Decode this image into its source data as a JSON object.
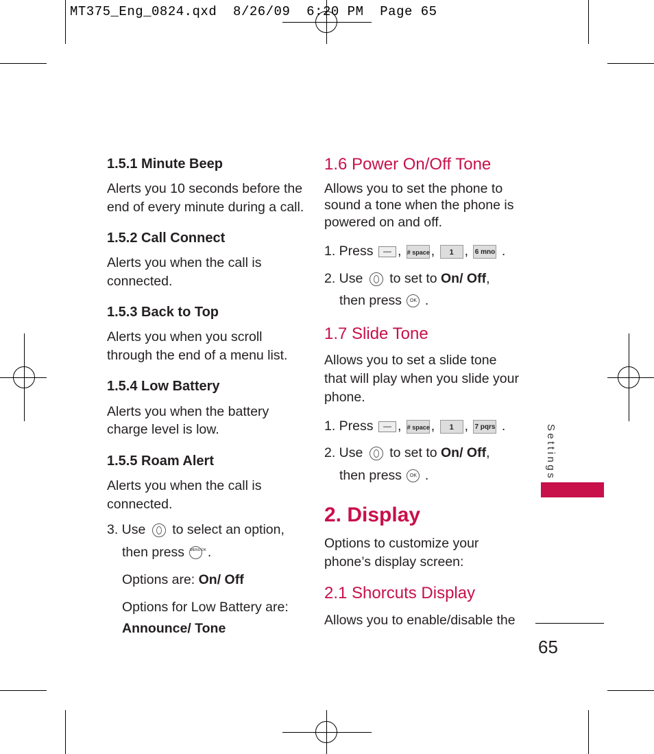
{
  "slug": "MT375_Eng_0824.qxd  8/26/09  6:20 PM  Page 65",
  "left_column": {
    "s151": {
      "title": "1.5.1 Minute Beep",
      "lines": [
        "Alerts you 10 seconds before the",
        "end of every minute during a call."
      ]
    },
    "s152": {
      "title": "1.5.2 Call Connect",
      "lines": [
        "Alerts you when the call is",
        "connected."
      ]
    },
    "s153": {
      "title": "1.5.3 Back to Top",
      "lines": [
        "Alerts you when you scroll",
        "through the end of a menu list."
      ]
    },
    "s154": {
      "title": "1.5.4 Low Battery",
      "lines": [
        "Alerts you when the battery",
        "charge level is low."
      ]
    },
    "s155": {
      "title": "1.5.5 Roam Alert",
      "lines": [
        "Alerts you when the call is",
        "connected."
      ]
    },
    "step3": {
      "prefix": "3. Use",
      "middle": "to select an option,",
      "line2": "then press",
      "end": "."
    },
    "options": {
      "label": "Options are: ",
      "value": "On/ Off"
    },
    "options_battery": {
      "label": "Options for Low Battery are:",
      "value": "Announce/ Tone"
    }
  },
  "right_column": {
    "s16": {
      "title": "1.6 Power On/Off Tone",
      "lines": [
        "Allows you to set the phone to",
        "sound a tone when the phone is",
        "powered on and off."
      ],
      "step1": {
        "prefix": "1. Press",
        "keys": [
          "—",
          "# space",
          "1",
          "6 mno"
        ]
      },
      "step2": {
        "prefix": "2. Use",
        "middle": "to set to ",
        "value": "On/ Off",
        "suffix": ",",
        "line2": "then press",
        "end": "."
      }
    },
    "s17": {
      "title": "1.7 Slide Tone",
      "lines": [
        "Allows you to set a slide tone",
        "that will play when you slide your",
        "phone."
      ],
      "step1": {
        "prefix": "1. Press",
        "keys": [
          "—",
          "# space",
          "1",
          "7 pqrs"
        ]
      },
      "step2": {
        "prefix": "2. Use",
        "middle": "to set to ",
        "value": "On/ Off",
        "suffix": ",",
        "line2": "then press",
        "end": "."
      }
    },
    "s2": {
      "title": "2. Display",
      "lines": [
        "Options to customize your",
        "phone’s display screen:"
      ]
    },
    "s21": {
      "title": "2.1 Shorcuts Display",
      "lines": [
        "Allows you to enable/disable the"
      ]
    }
  },
  "side_tab": {
    "label": "Settings",
    "color": "#c8104b"
  },
  "page_number": "65",
  "ok_label": "OK",
  "menu_ok_label": "MENU OK"
}
